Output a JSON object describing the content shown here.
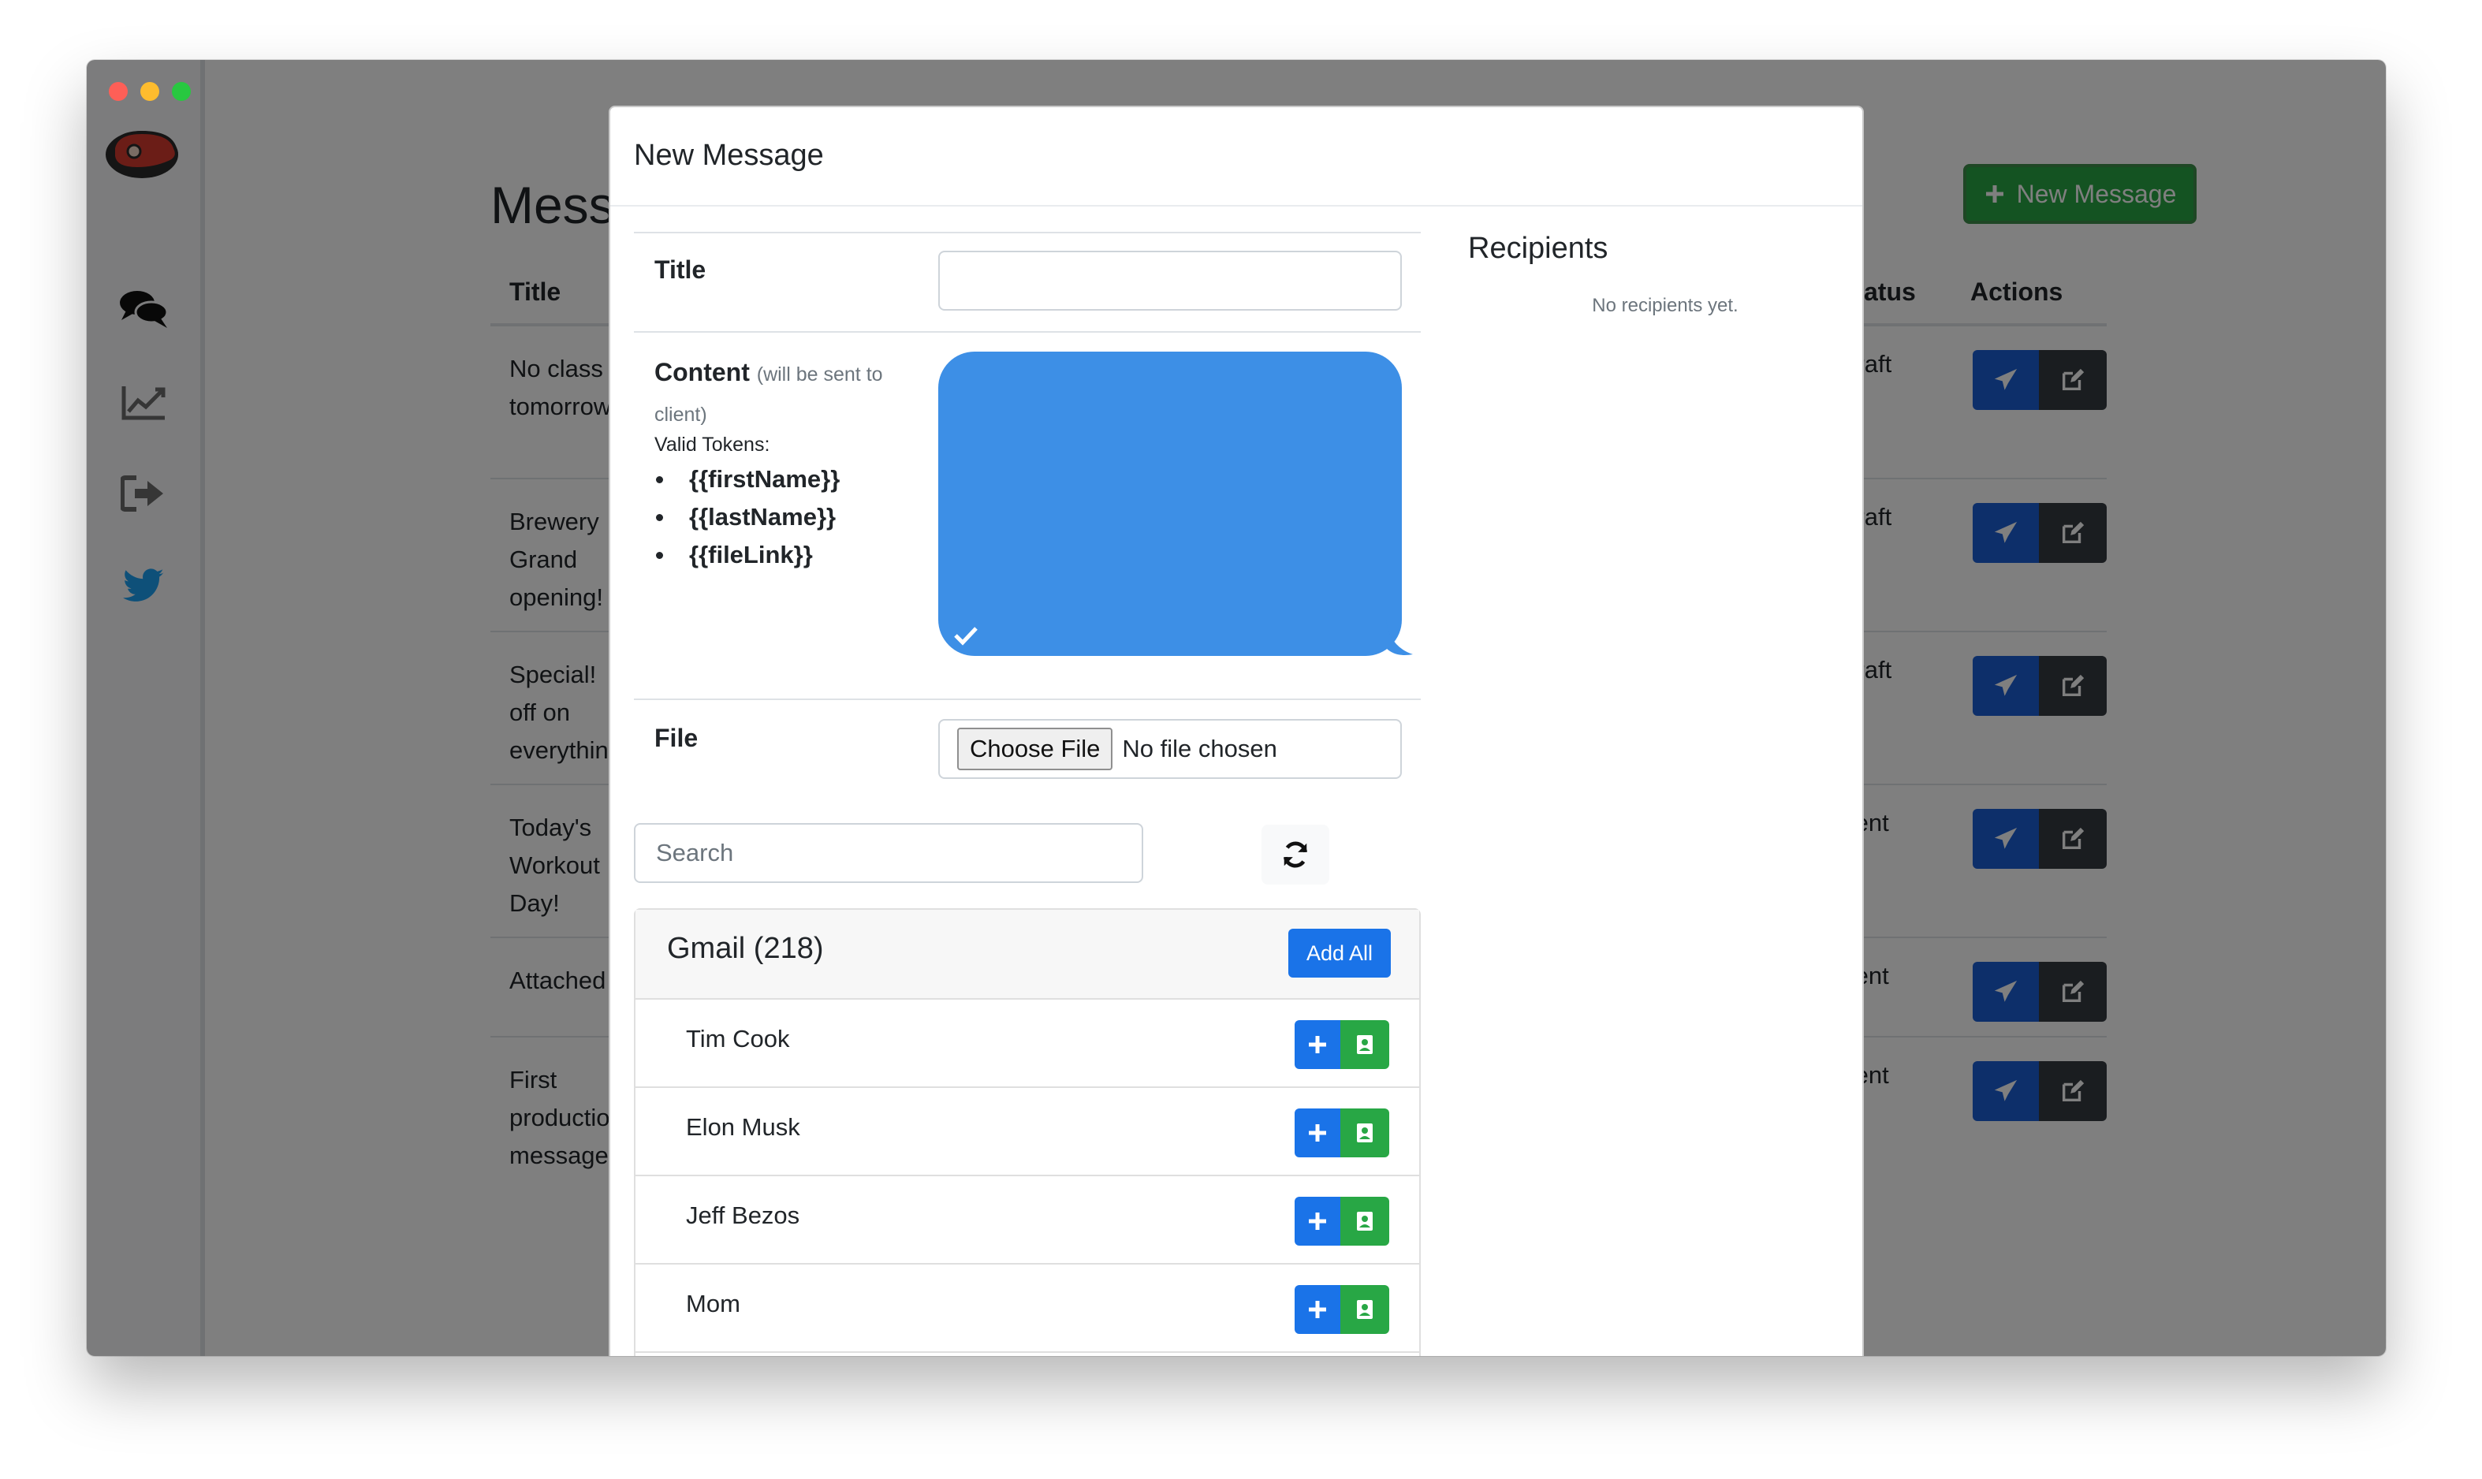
{
  "sidebar": {
    "icons": [
      "steak-logo-icon",
      "chat-bubbles-icon",
      "line-chart-icon",
      "sign-out-icon",
      "twitter-icon"
    ]
  },
  "page": {
    "title": "Messages",
    "new_message_button": "New Message",
    "table": {
      "headers": [
        "Title",
        "Status",
        "Actions"
      ],
      "rows": [
        {
          "title": "No class tomorrow",
          "status": "Draft"
        },
        {
          "title": "Brewery Grand opening!",
          "status": "Draft"
        },
        {
          "title": "Special! off on everything",
          "status": "Draft"
        },
        {
          "title": "Today's Workout Day!",
          "status": "Sent"
        },
        {
          "title": "Attached",
          "status": "Sent"
        },
        {
          "title": "First production message",
          "status": "Sent"
        }
      ]
    }
  },
  "modal": {
    "title": "New Message",
    "title_label": "Title",
    "content_label": "Content",
    "content_note": "(will be sent to client)",
    "valid_tokens_label": "Valid Tokens:",
    "tokens": [
      "{{firstName}}",
      "{{lastName}}",
      "{{fileLink}}"
    ],
    "file_label": "File",
    "choose_file": "Choose File",
    "no_file": "No file chosen",
    "search_placeholder": "Search",
    "group": {
      "title": "Gmail (218)",
      "add_all": "Add All",
      "contacts": [
        "Tim Cook",
        "Elon Musk",
        "Jeff Bezos",
        "Mom"
      ]
    },
    "recipients_title": "Recipients",
    "no_recipients": "No recipients yet."
  },
  "colors": {
    "primary": "#1a73e8",
    "success": "#28a745",
    "dark": "#343a40",
    "bubble": "#3d8fe6"
  }
}
